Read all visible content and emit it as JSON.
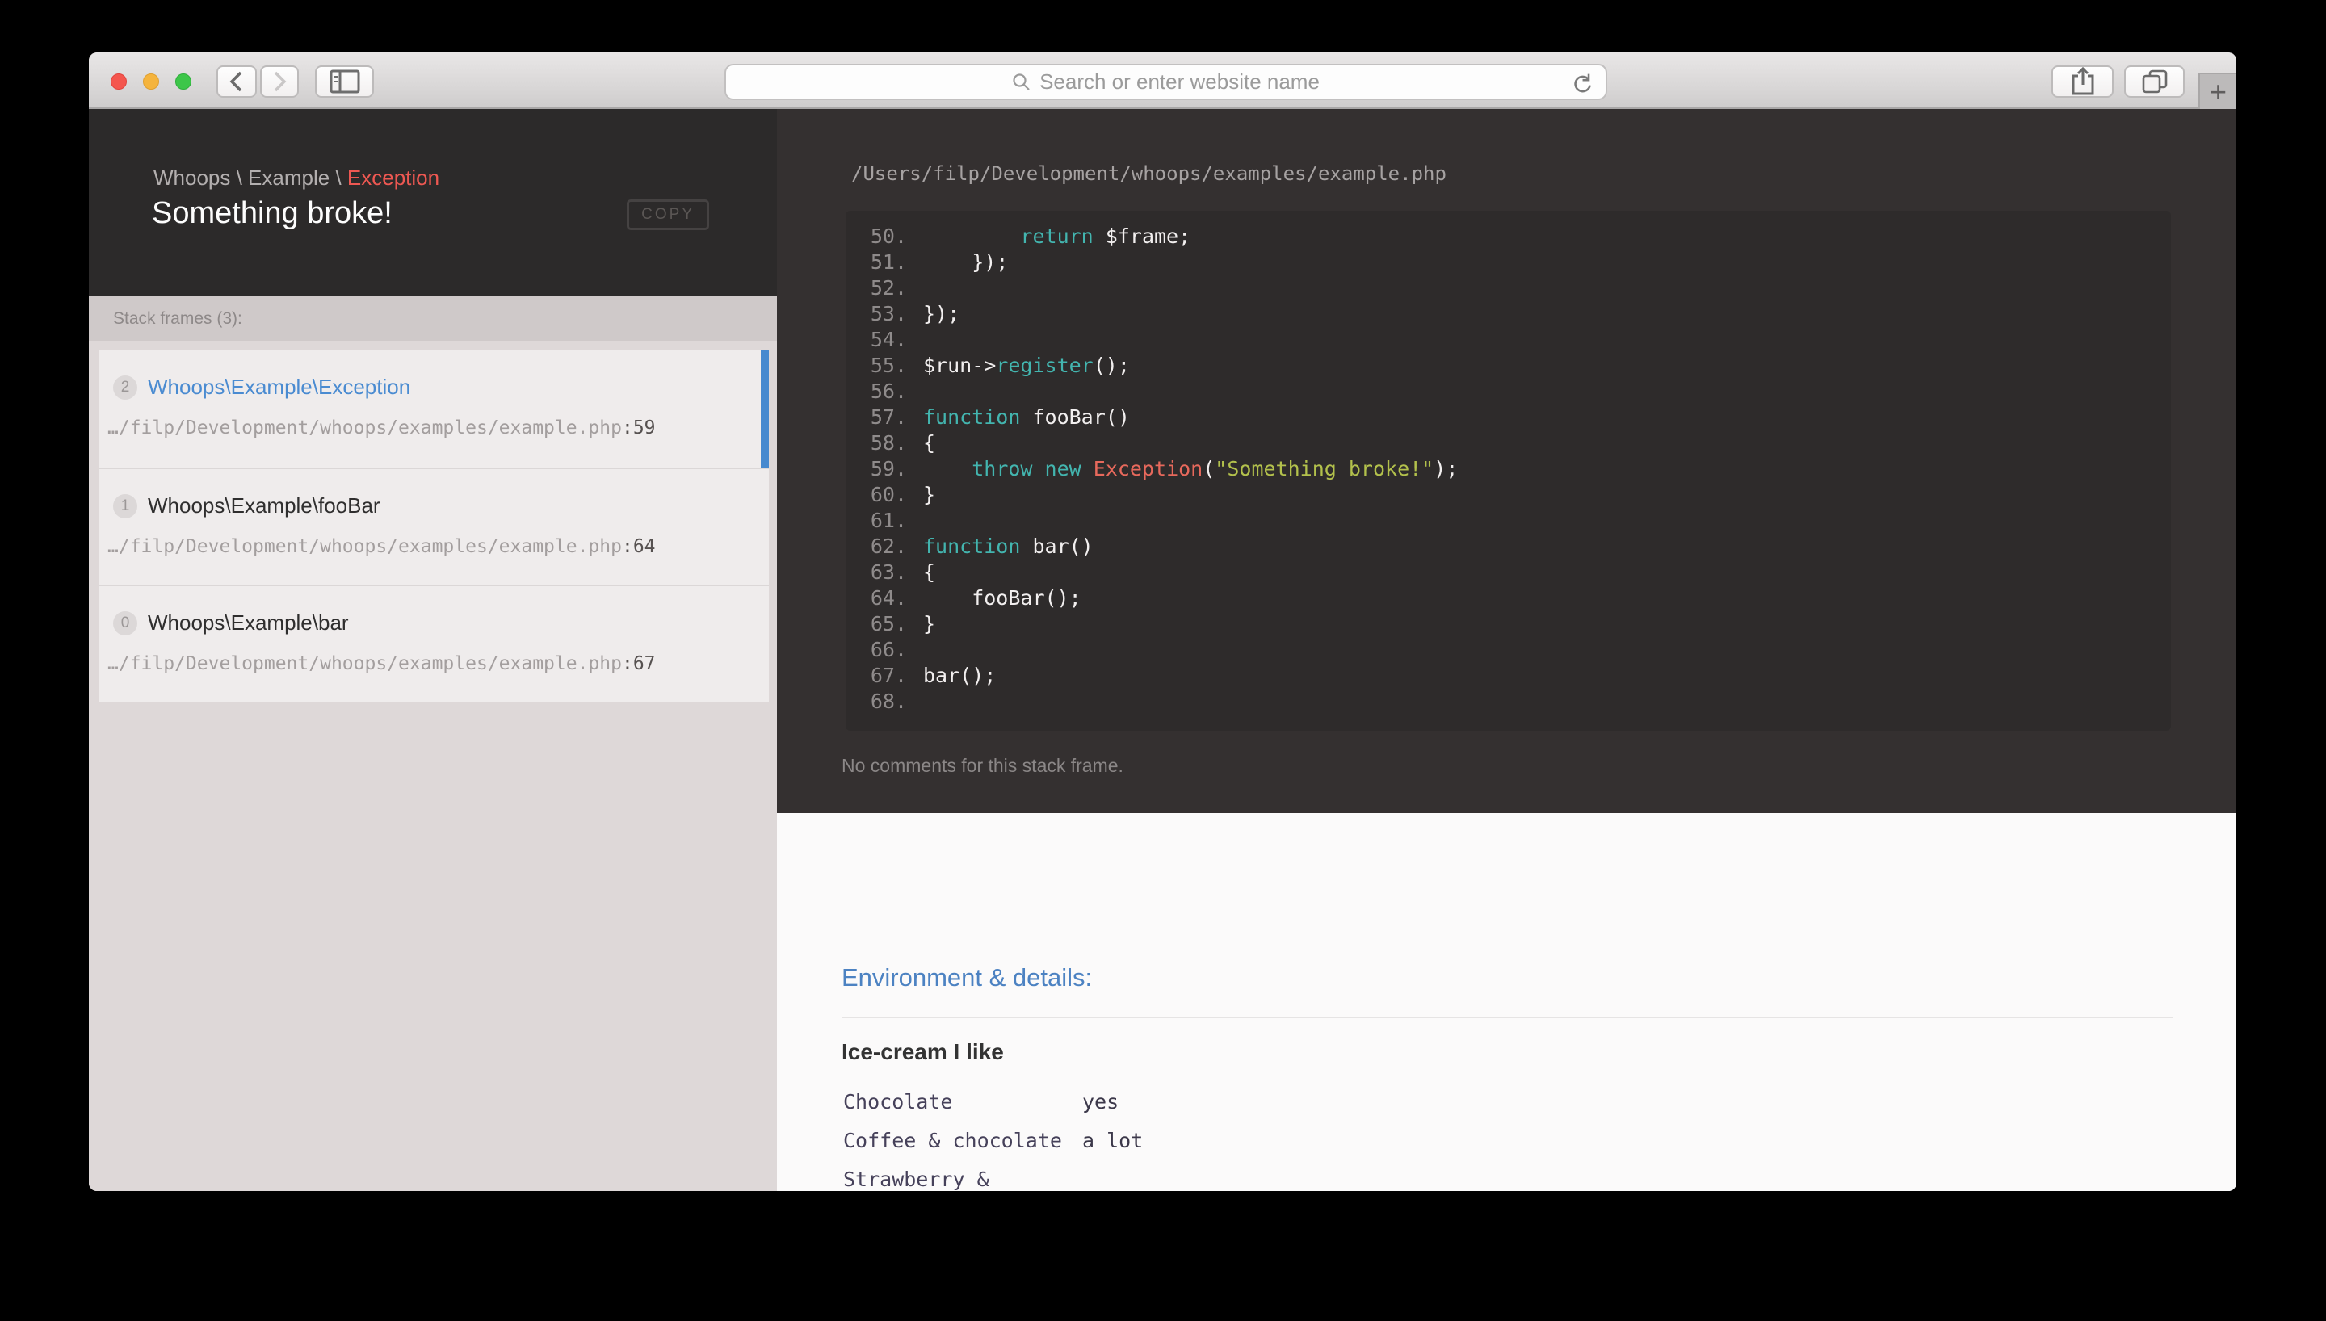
{
  "browser": {
    "url_placeholder": "Search or enter website name",
    "new_tab_label": "+"
  },
  "colors": {
    "exception_red": "#ee5852",
    "active_frame_blue": "#4a8bd1",
    "active_stripe_blue": "#4689cf",
    "syntax_keyword_teal": "#43b5af",
    "syntax_class_salmon": "#e8695c",
    "syntax_string_green": "#b3c14c",
    "env_heading_blue": "#4c82c2"
  },
  "left_panel": {
    "breadcrumb_prefix": "Whoops \\ Example \\ ",
    "breadcrumb_current": "Exception",
    "title": "Something broke!",
    "copy_label": "COPY",
    "stack_frames_label": "Stack frames (3):",
    "frames": [
      {
        "index": "2",
        "title": "Whoops\\Example\\Exception",
        "path": "…/filp/Development/whoops/examples/example.php",
        "line": ":59",
        "active": true
      },
      {
        "index": "1",
        "title": "Whoops\\Example\\fooBar",
        "path": "…/filp/Development/whoops/examples/example.php",
        "line": ":64",
        "active": false
      },
      {
        "index": "0",
        "title": "Whoops\\Example\\bar",
        "path": "…/filp/Development/whoops/examples/example.php",
        "line": ":67",
        "active": false
      }
    ]
  },
  "code_panel": {
    "file_path": "/Users/filp/Development/whoops/examples/example.php",
    "no_comments": "No comments for this stack frame.",
    "lines": [
      {
        "no": "50.",
        "tok": [
          [
            "plain",
            "        "
          ],
          [
            "kw",
            "return"
          ],
          [
            "plain",
            " $frame;"
          ]
        ]
      },
      {
        "no": "51.",
        "tok": [
          [
            "plain",
            "    });"
          ]
        ]
      },
      {
        "no": "52.",
        "tok": []
      },
      {
        "no": "53.",
        "tok": [
          [
            "plain",
            "});"
          ]
        ]
      },
      {
        "no": "54.",
        "tok": []
      },
      {
        "no": "55.",
        "tok": [
          [
            "plain",
            "$run->"
          ],
          [
            "kw",
            "register"
          ],
          [
            "plain",
            "();"
          ]
        ]
      },
      {
        "no": "56.",
        "tok": []
      },
      {
        "no": "57.",
        "tok": [
          [
            "kw",
            "function"
          ],
          [
            "plain",
            " fooBar()"
          ]
        ]
      },
      {
        "no": "58.",
        "tok": [
          [
            "plain",
            "{"
          ]
        ]
      },
      {
        "no": "59.",
        "tok": [
          [
            "plain",
            "    "
          ],
          [
            "kw",
            "throw"
          ],
          [
            "plain",
            " "
          ],
          [
            "kw",
            "new"
          ],
          [
            "plain",
            " "
          ],
          [
            "cls",
            "Exception"
          ],
          [
            "plain",
            "("
          ],
          [
            "str",
            "\"Something broke!\""
          ],
          [
            "plain",
            ");"
          ]
        ]
      },
      {
        "no": "60.",
        "tok": [
          [
            "plain",
            "}"
          ]
        ]
      },
      {
        "no": "61.",
        "tok": []
      },
      {
        "no": "62.",
        "tok": [
          [
            "kw",
            "function"
          ],
          [
            "plain",
            " bar()"
          ]
        ]
      },
      {
        "no": "63.",
        "tok": [
          [
            "plain",
            "{"
          ]
        ]
      },
      {
        "no": "64.",
        "tok": [
          [
            "plain",
            "    fooBar();"
          ]
        ]
      },
      {
        "no": "65.",
        "tok": [
          [
            "plain",
            "}"
          ]
        ]
      },
      {
        "no": "66.",
        "tok": []
      },
      {
        "no": "67.",
        "tok": [
          [
            "plain",
            "bar();"
          ]
        ]
      },
      {
        "no": "68.",
        "tok": []
      }
    ]
  },
  "details": {
    "heading": "Environment & details:",
    "section_title": "Ice-cream I like",
    "rows": [
      {
        "key": "Chocolate",
        "value": "yes"
      },
      {
        "key": "Coffee & chocolate",
        "value": "a lot"
      },
      {
        "key": "Strawberry &",
        "value": ""
      }
    ]
  }
}
